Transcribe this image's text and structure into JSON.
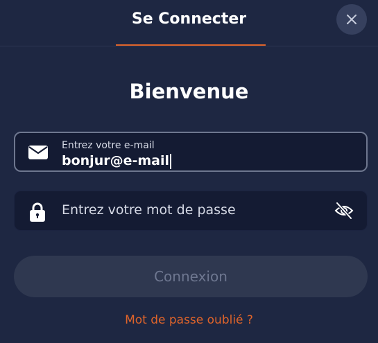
{
  "header": {
    "title": "Se Connecter",
    "close_icon": "close-icon",
    "accent_color": "#e0642a"
  },
  "welcome": "Bienvenue",
  "email_field": {
    "label": "Entrez votre e-mail",
    "value": "bonjur@e-mail",
    "icon": "envelope-icon"
  },
  "password_field": {
    "placeholder": "Entrez votre mot de passe",
    "icon": "lock-icon",
    "toggle_icon": "eye-off-icon"
  },
  "submit_label": "Connexion",
  "forgot_link": "Mot de passe oublié ?"
}
